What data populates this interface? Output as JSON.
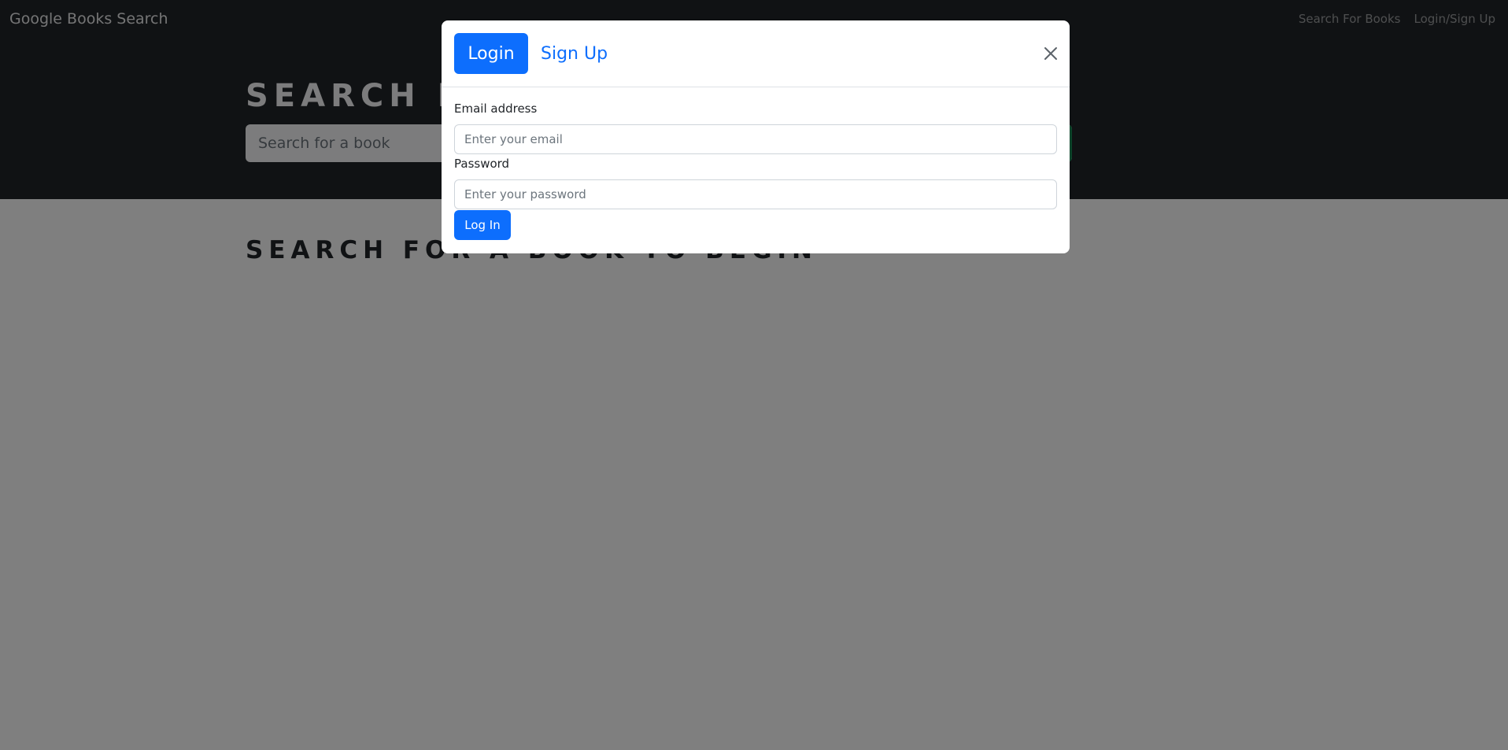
{
  "navbar": {
    "brand": "Google Books Search",
    "links": [
      "Search For Books",
      "Login/Sign Up"
    ]
  },
  "hero": {
    "title": "SEARCH FOR BOOKS!",
    "search": {
      "placeholder": "Search for a book"
    },
    "submit_color": "#198754"
  },
  "main": {
    "heading": "SEARCH FOR A BOOK TO BEGIN"
  },
  "modal": {
    "tabs": {
      "login": "Login",
      "signup": "Sign Up"
    },
    "email": {
      "label": "Email address",
      "placeholder": "Enter your email"
    },
    "password": {
      "label": "Password",
      "placeholder": "Enter your password"
    },
    "submit": "Log In"
  },
  "colors": {
    "dark_bg": "#212529",
    "primary": "#0d6efd",
    "success": "#198754"
  }
}
